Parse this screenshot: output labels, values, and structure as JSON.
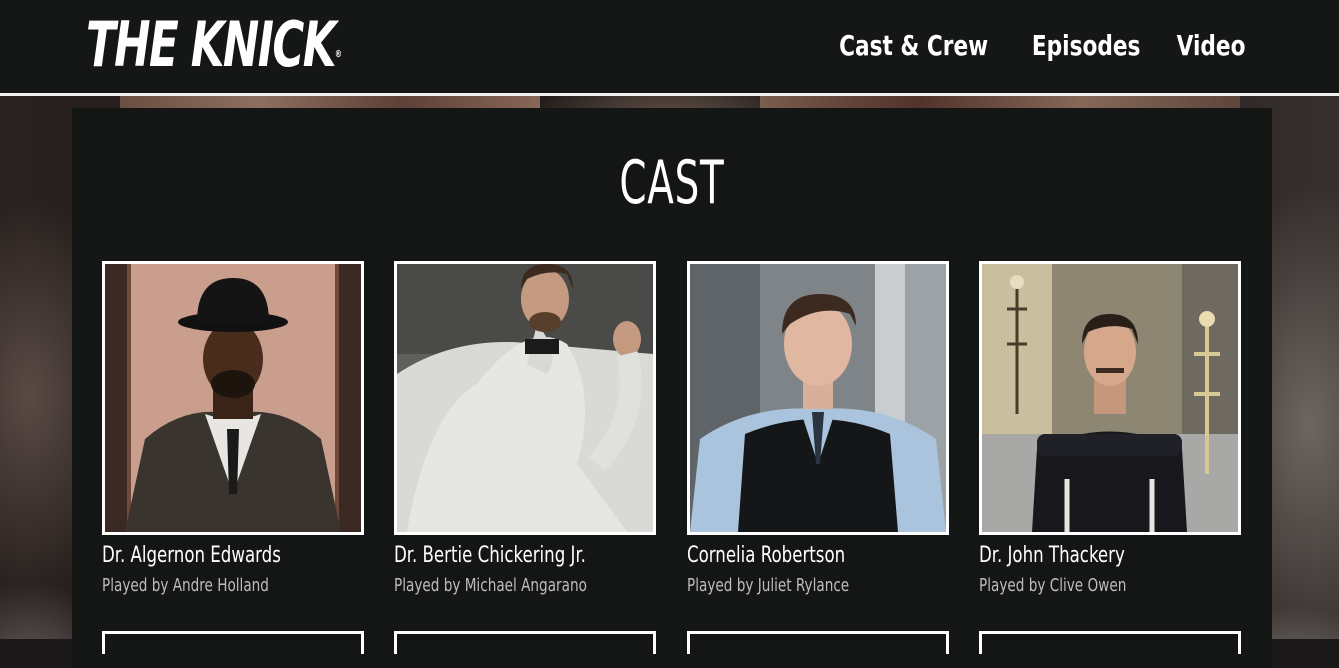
{
  "site": {
    "logo": "THE KNICK",
    "logo_mark": "®"
  },
  "nav": {
    "items": [
      {
        "label": "Cast & Crew"
      },
      {
        "label": "Episodes"
      },
      {
        "label": "Video"
      }
    ]
  },
  "main": {
    "title": "CAST",
    "cast": [
      {
        "name": "Dr. Algernon Edwards",
        "actor": "Played by Andre Holland"
      },
      {
        "name": "Dr. Bertie Chickering Jr.",
        "actor": "Played by Michael Angarano"
      },
      {
        "name": "Cornelia Robertson",
        "actor": "Played by Juliet Rylance"
      },
      {
        "name": "Dr. John Thackery",
        "actor": "Played by Clive Owen"
      }
    ]
  }
}
